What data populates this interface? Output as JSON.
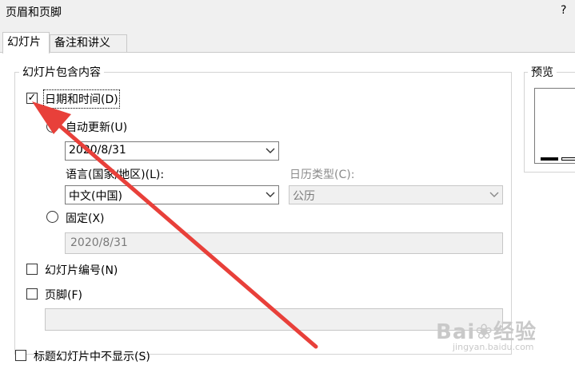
{
  "window": {
    "title": "页眉和页脚",
    "help": "?"
  },
  "tabs": [
    {
      "label": "幻灯片",
      "active": true
    },
    {
      "label": "备注和讲义",
      "active": false
    }
  ],
  "group": {
    "label": "幻灯片包含内容"
  },
  "date_time": {
    "label": "日期和时间(D)",
    "checked": true
  },
  "auto_update": {
    "label": "自动更新(U)",
    "selected": true,
    "value": "2020/8/31"
  },
  "language": {
    "label": "语言(国家/地区)(L):",
    "value": "中文(中国)"
  },
  "calendar": {
    "label": "日历类型(C):",
    "value": "公历"
  },
  "fixed": {
    "label": "固定(X)",
    "selected": false,
    "value": "2020/8/31"
  },
  "slide_number": {
    "label": "幻灯片编号(N)",
    "checked": false
  },
  "footer": {
    "label": "页脚(F)",
    "checked": false,
    "value": ""
  },
  "hide_title": {
    "label": "标题幻灯片中不显示(S)",
    "checked": false
  },
  "preview": {
    "label": "预览"
  },
  "watermark": {
    "text": "Bai❀经验",
    "sub": "jingyan.baidu.com"
  },
  "colors": {
    "arrow": "#e8403a",
    "border": "#7a7a7a",
    "disabled_text": "#8a8a8a"
  }
}
